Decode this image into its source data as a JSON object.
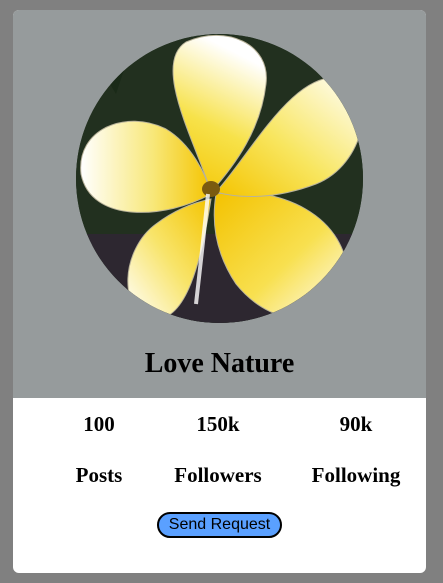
{
  "profile": {
    "name": "Love Nature",
    "image": "frangipani-flower-photo"
  },
  "stats": {
    "values": [
      "100",
      "150k",
      "90k"
    ],
    "labels": [
      "Posts",
      "Followers",
      "Following"
    ]
  },
  "actions": {
    "send_request_label": "Send Request"
  },
  "colors": {
    "page_background": "#808080",
    "card_top_background": "#969b9c",
    "card_bottom_background": "#ffffff",
    "button_background": "#5aa0ff"
  }
}
